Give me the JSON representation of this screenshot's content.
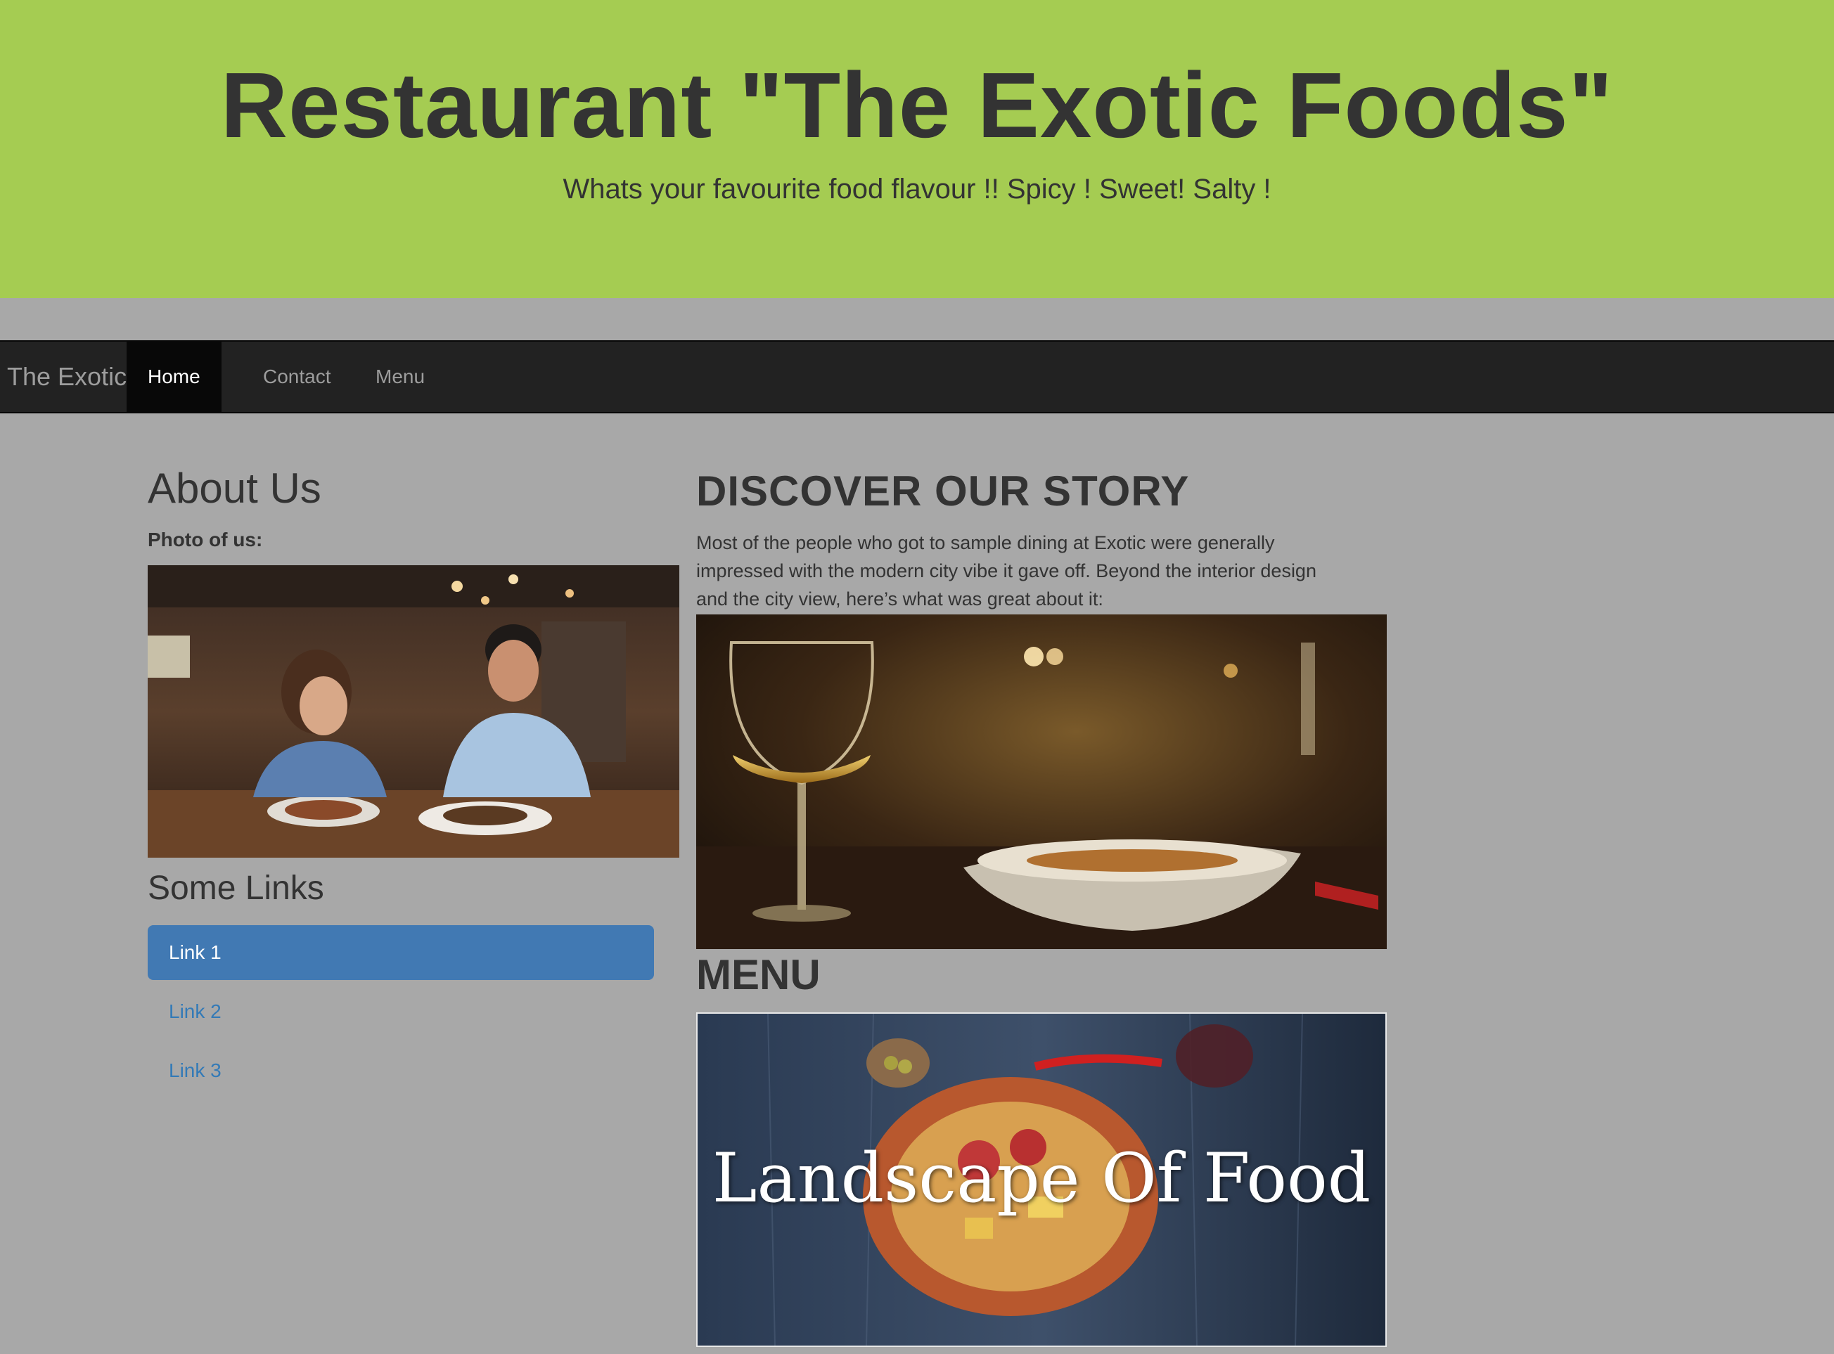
{
  "header": {
    "title": "Restaurant \"The Exotic Foods\"",
    "subtitle": "Whats your favourite food flavour !! Spicy ! Sweet! Salty !"
  },
  "navbar": {
    "brand": "The Exotic",
    "items": [
      {
        "label": "Home",
        "active": true
      },
      {
        "label": "Contact",
        "active": false
      },
      {
        "label": "Menu",
        "active": false
      }
    ]
  },
  "about": {
    "title": "About Us",
    "photo_label": "Photo of us:",
    "photo_alt": "couple-dining-photo"
  },
  "links": {
    "title": "Some Links",
    "items": [
      {
        "label": "Link 1",
        "active": true
      },
      {
        "label": "Link 2",
        "active": false
      },
      {
        "label": "Link 3",
        "active": false
      }
    ]
  },
  "story": {
    "title": "DISCOVER OUR STORY",
    "text": "Most of the people who got to sample dining at Exotic were generally impressed with the modern city vibe it gave off. Beyond the interior design and the city view, here’s what was great about it:"
  },
  "menu": {
    "title": "MENU",
    "image_caption": "Landscape Of Food"
  },
  "colors": {
    "header_bg": "#a5cc52",
    "page_bg": "#a8a8a8",
    "navbar_bg": "#222222",
    "link_active_bg": "#4179b3",
    "link_color": "#337ab7"
  }
}
